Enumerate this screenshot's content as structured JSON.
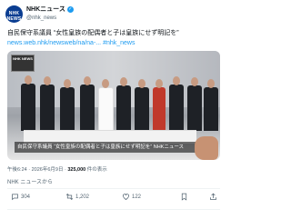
{
  "account": {
    "name": "NHKニュース",
    "handle": "@nhk_news",
    "avatar_text": "NHK NEWS"
  },
  "post": {
    "text": "自民保守系議員 “女性皇族の配偶者と子は皇族にせず明記を”",
    "link": "news.web.nhk/newsweb/na/na-...",
    "hashtag": "#nhk_news",
    "video_caption": "自民保守系議員 “女性皇族の配偶者と子は皇族にせず明記を” NHKニュース",
    "video_logo": "NHK NEWS",
    "meta_time": "午後6:24 · 2026年6月9日 ·",
    "meta_views": "325,000",
    "meta_views_label": "件の表示",
    "translation": "NHK ニュースから"
  },
  "actions": {
    "replies": "304",
    "reposts": "1,202",
    "likes": "122",
    "bookmark": ""
  },
  "colors": {
    "link": "#1d9bf0",
    "muted": "#536471",
    "brand": "#0a3d91"
  }
}
